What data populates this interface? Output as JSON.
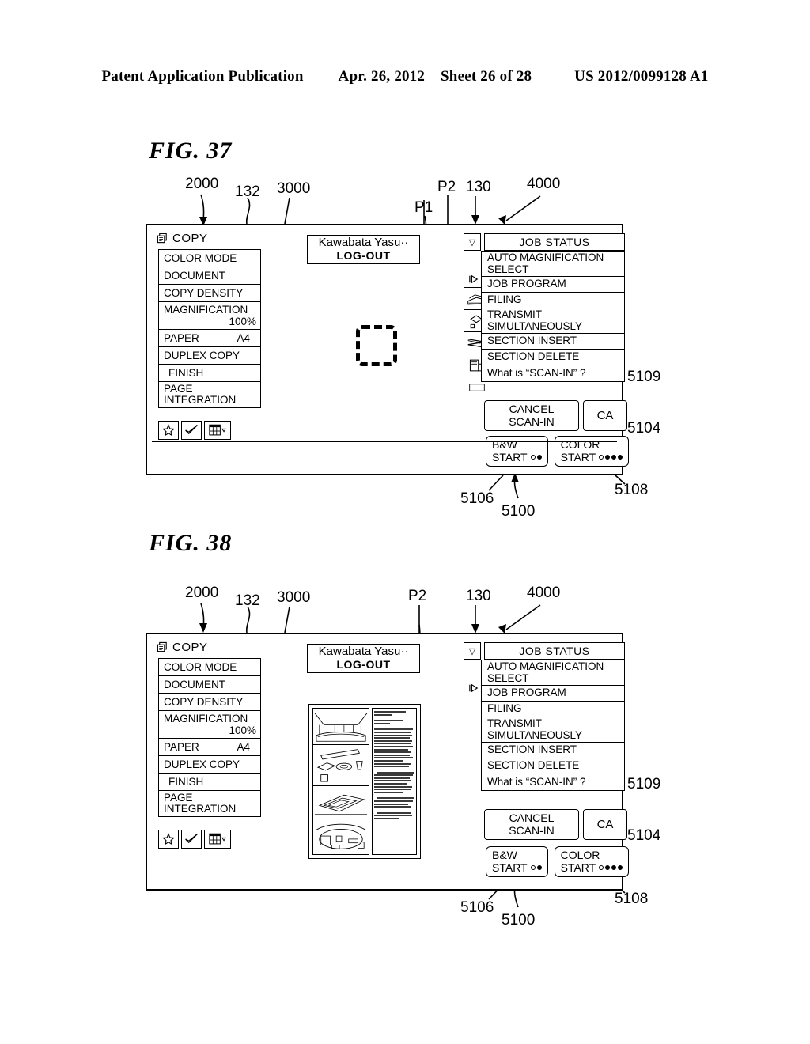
{
  "patent_header": {
    "publication": "Patent Application Publication",
    "date": "Apr. 26, 2012",
    "sheet": "Sheet 26 of 28",
    "number": "US 2012/0099128 A1"
  },
  "figures": [
    {
      "title": "FIG. 37",
      "callouts": [
        {
          "id": "c37-2000",
          "text": "2000"
        },
        {
          "id": "c37-132",
          "text": "132"
        },
        {
          "id": "c37-3000",
          "text": "3000"
        },
        {
          "id": "c37-p1",
          "text": "P1"
        },
        {
          "id": "c37-p2",
          "text": "P2"
        },
        {
          "id": "c37-130",
          "text": "130"
        },
        {
          "id": "c37-4000",
          "text": "4000"
        },
        {
          "id": "c37-5109",
          "text": "5109"
        },
        {
          "id": "c37-5104",
          "text": "5104"
        },
        {
          "id": "c37-5106",
          "text": "5106"
        },
        {
          "id": "c37-5100",
          "text": "5100"
        },
        {
          "id": "c37-5108",
          "text": "5108"
        }
      ],
      "screen": {
        "app_label": "COPY",
        "app_icon": "copy-icon",
        "left_menu": [
          {
            "label": "COLOR MODE",
            "value": ""
          },
          {
            "label": "DOCUMENT",
            "value": ""
          },
          {
            "label": "COPY DENSITY",
            "value": ""
          },
          {
            "label": "MAGNIFICATION",
            "value": "100%"
          },
          {
            "label": "PAPER",
            "value": "A4"
          },
          {
            "label": "DUPLEX COPY",
            "value": ""
          },
          {
            "label": "FINISH",
            "value": ""
          },
          {
            "label": "PAGE INTEGRATION",
            "value": ""
          }
        ],
        "icon_buttons": [
          {
            "name": "favorite-star-icon",
            "glyph": "star"
          },
          {
            "name": "check-icon",
            "glyph": "check"
          },
          {
            "name": "grid-list-icon",
            "glyph": "grid"
          }
        ],
        "login": {
          "user": "Kawabata Yasu··",
          "action": "LOG-OUT"
        },
        "preview": {
          "kind": "dashed-placeholder",
          "label": "P1"
        },
        "job_status_label": "JOB STATUS",
        "dropdown_glyph": "▽",
        "popup_menu": [
          "AUTO MAGNIFICATION SELECT",
          "JOB PROGRAM",
          "FILING",
          "TRANSMIT SIMULTANEOUSLY",
          "SECTION INSERT",
          "SECTION DELETE",
          "What is “SCAN-IN” ?"
        ],
        "cancel_button": {
          "line1": "CANCEL",
          "line2": "SCAN-IN"
        },
        "ca_button": "CA",
        "start_buttons": [
          {
            "line1": "B&W",
            "line2": "START",
            "dots": [
              "hollow",
              "filled"
            ]
          },
          {
            "line1": "COLOR",
            "line2": "START",
            "dots": [
              "hollow",
              "filled",
              "filled",
              "filled"
            ]
          }
        ]
      }
    },
    {
      "title": "FIG. 38",
      "callouts": [
        {
          "id": "c38-2000",
          "text": "2000"
        },
        {
          "id": "c38-132",
          "text": "132"
        },
        {
          "id": "c38-3000",
          "text": "3000"
        },
        {
          "id": "c38-p2",
          "text": "P2"
        },
        {
          "id": "c38-130",
          "text": "130"
        },
        {
          "id": "c38-4000",
          "text": "4000"
        },
        {
          "id": "c38-5109",
          "text": "5109"
        },
        {
          "id": "c38-5104",
          "text": "5104"
        },
        {
          "id": "c38-5106",
          "text": "5106"
        },
        {
          "id": "c38-5100",
          "text": "5100"
        },
        {
          "id": "c38-5108",
          "text": "5108"
        }
      ],
      "screen": {
        "app_label": "COPY",
        "app_icon": "copy-icon",
        "left_menu": [
          {
            "label": "COLOR MODE",
            "value": ""
          },
          {
            "label": "DOCUMENT",
            "value": ""
          },
          {
            "label": "COPY DENSITY",
            "value": ""
          },
          {
            "label": "MAGNIFICATION",
            "value": "100%"
          },
          {
            "label": "PAPER",
            "value": "A4"
          },
          {
            "label": "DUPLEX COPY",
            "value": ""
          },
          {
            "label": "FINISH",
            "value": ""
          },
          {
            "label": "PAGE INTEGRATION",
            "value": ""
          }
        ],
        "icon_buttons": [
          {
            "name": "favorite-star-icon",
            "glyph": "star"
          },
          {
            "name": "check-icon",
            "glyph": "check"
          },
          {
            "name": "grid-list-icon",
            "glyph": "grid"
          }
        ],
        "login": {
          "user": "Kawabata Yasu··",
          "action": "LOG-OUT"
        },
        "preview": {
          "kind": "document-thumbnail",
          "label": "P2"
        },
        "job_status_label": "JOB STATUS",
        "dropdown_glyph": "▽",
        "popup_menu": [
          "AUTO MAGNIFICATION SELECT",
          "JOB PROGRAM",
          "FILING",
          "TRANSMIT SIMULTANEOUSLY",
          "SECTION INSERT",
          "SECTION DELETE",
          "What is “SCAN-IN” ?"
        ],
        "cancel_button": {
          "line1": "CANCEL",
          "line2": "SCAN-IN"
        },
        "ca_button": "CA",
        "start_buttons": [
          {
            "line1": "B&W",
            "line2": "START",
            "dots": [
              "hollow",
              "filled"
            ]
          },
          {
            "line1": "COLOR",
            "line2": "START",
            "dots": [
              "hollow",
              "filled",
              "filled",
              "filled"
            ]
          }
        ]
      }
    }
  ]
}
